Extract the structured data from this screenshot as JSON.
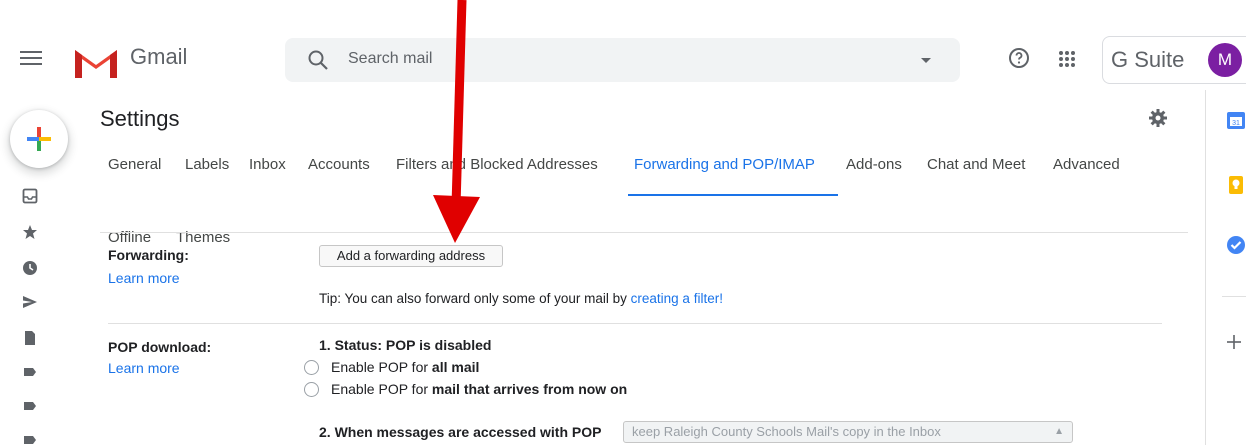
{
  "header": {
    "app_name": "Gmail",
    "search_placeholder": "Search mail",
    "suite_label": "G Suite",
    "avatar_initial": "M"
  },
  "settings": {
    "title": "Settings",
    "tabs": [
      {
        "label": "General"
      },
      {
        "label": "Labels"
      },
      {
        "label": "Inbox"
      },
      {
        "label": "Accounts"
      },
      {
        "label": "Filters and Blocked Addresses"
      },
      {
        "label": "Forwarding and POP/IMAP",
        "active": true
      },
      {
        "label": "Add-ons"
      },
      {
        "label": "Chat and Meet"
      },
      {
        "label": "Advanced"
      },
      {
        "label": "Offline"
      },
      {
        "label": "Themes"
      }
    ]
  },
  "forwarding": {
    "label": "Forwarding:",
    "learn_more": "Learn more",
    "add_button": "Add a forwarding address",
    "tip_prefix": "Tip: You can also forward only some of your mail by ",
    "tip_link": "creating a filter!"
  },
  "pop": {
    "label": "POP download:",
    "learn_more": "Learn more",
    "status": "1. Status: POP is disabled",
    "option1_prefix": "Enable POP for ",
    "option1_bold": "all mail",
    "option2_prefix": "Enable POP for ",
    "option2_bold": "mail that arrives from now on",
    "when_label": "2. When messages are accessed with POP",
    "when_select_value": "keep Raleigh County Schools Mail's copy in the Inbox"
  },
  "colors": {
    "accent": "#1a73e8",
    "arrow": "#e00000",
    "avatar_bg": "#7b1fa2"
  }
}
